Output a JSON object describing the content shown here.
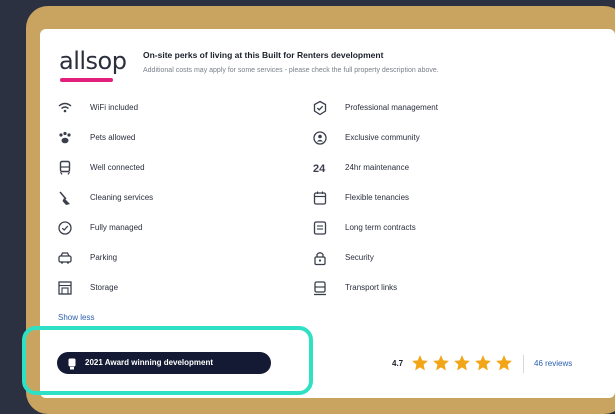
{
  "header": {
    "logo_text": "allsop",
    "title": "On-site perks of living at this Built for Renters development",
    "subtitle": "Additional costs may apply for some services - please check the full property description above."
  },
  "features_left": [
    {
      "label": "WiFi included",
      "icon": "wifi-icon"
    },
    {
      "label": "Pets allowed",
      "icon": "paw-icon"
    },
    {
      "label": "Well connected",
      "icon": "train-icon"
    },
    {
      "label": "Cleaning services",
      "icon": "broom-icon"
    },
    {
      "label": "Fully managed",
      "icon": "check-shield-icon"
    },
    {
      "label": "Parking",
      "icon": "car-icon"
    },
    {
      "label": "Storage",
      "icon": "storage-icon"
    }
  ],
  "features_right": [
    {
      "label": "Professional management",
      "icon": "badge-check-icon"
    },
    {
      "label": "Exclusive community",
      "icon": "community-icon"
    },
    {
      "label": "24hr maintenance",
      "icon": "tools-icon"
    },
    {
      "label": "Flexible tenancies",
      "icon": "calendar-icon"
    },
    {
      "label": "Long term contracts",
      "icon": "contract-icon"
    },
    {
      "label": "Security",
      "icon": "lock-icon"
    },
    {
      "label": "Transport links",
      "icon": "bus-icon"
    }
  ],
  "show_less": "Show less",
  "award": {
    "label": "2021 Award winning development",
    "icon": "trophy-icon"
  },
  "rating": {
    "value": "4.7",
    "stars": 5,
    "reviews": "46 reviews"
  },
  "colors": {
    "accent": "#e21f7a",
    "star": "#f2a516",
    "award_bg": "#141a33",
    "highlight": "#2ee0c4",
    "frame": "#c9a460",
    "link": "#2a5fb0"
  }
}
